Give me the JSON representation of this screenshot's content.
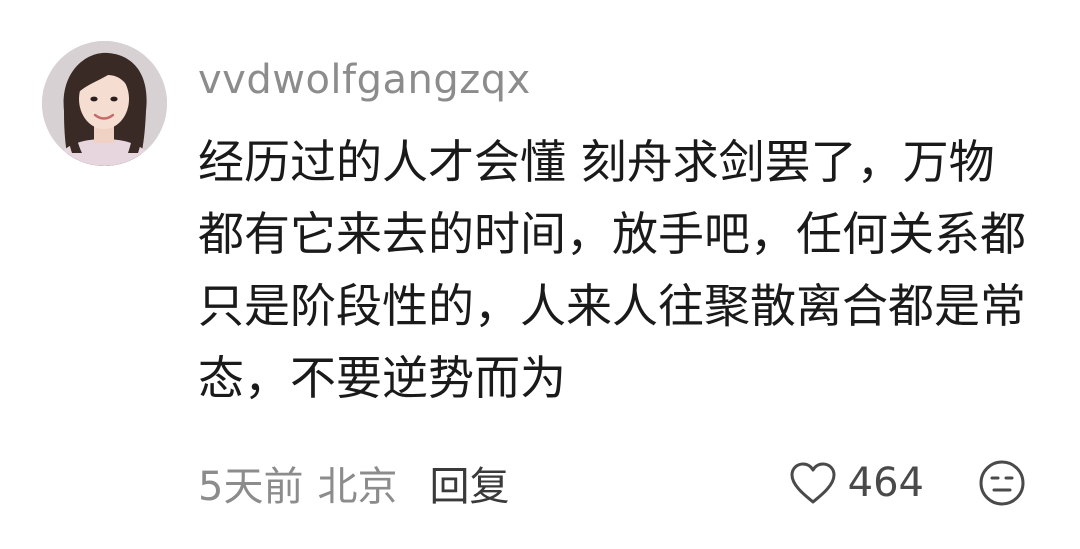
{
  "comment": {
    "username": "vvdwolfgangzqx",
    "text": "经历过的人才会懂 刻舟求剑罢了，万物都有它来去的时间，放手吧，任何关系都只是阶段性的，人来人往聚散离合都是常态，不要逆势而为",
    "time": "5天前",
    "location": "北京",
    "reply_label": "回复",
    "like_count": "464"
  },
  "icons": {
    "like": "heart-outline-icon",
    "dislike": "neutral-face-icon"
  },
  "colors": {
    "text_primary": "#1a1a1a",
    "text_secondary": "#8c8c8c",
    "background": "#ffffff"
  }
}
